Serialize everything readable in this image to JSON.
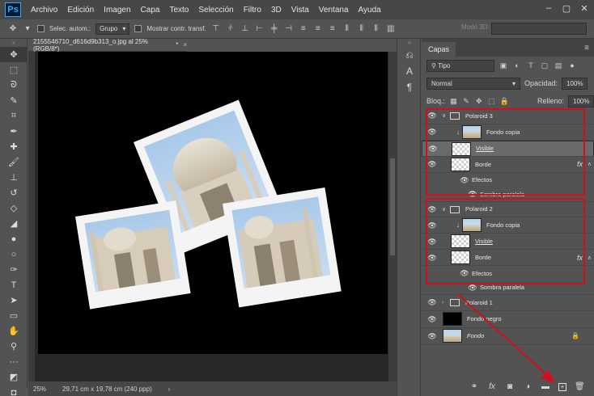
{
  "app": {
    "logo": "Ps"
  },
  "menu": [
    "Archivo",
    "Edición",
    "Imagen",
    "Capa",
    "Texto",
    "Selección",
    "Filtro",
    "3D",
    "Vista",
    "Ventana",
    "Ayuda"
  ],
  "options": {
    "auto_select_label": "Selec. autom.:",
    "auto_select_value": "Grupo",
    "transform_label": "Mostrar contr. transf.",
    "mode3d_label": "Modo 3D:"
  },
  "document": {
    "tab_title": "2155546710_d616d9b313_o.jpg al 25% (RGB/8*)",
    "tab_modified": "*",
    "close": "×"
  },
  "status": {
    "zoom": "25%",
    "size": "29,71 cm x 19,78 cm (240 ppp)"
  },
  "layers_panel": {
    "tab": "Capas",
    "filter_kind": "Tipo",
    "blend_mode": "Normal",
    "opacity_label": "Opacidad:",
    "opacity_value": "100%",
    "lock_label": "Bloq.:",
    "fill_label": "Relleno:",
    "fill_value": "100%",
    "layers": {
      "polaroid3": "Polaroid 3",
      "fondo_copia_1": "Fondo copia",
      "visible_1": "Visible",
      "borde_1": "Borde",
      "efectos_1": "Efectos",
      "sombra_1": "Sombra paralela",
      "polaroid2": "Polaroid 2",
      "fondo_copia_2": "Fondo copia",
      "visible_2": "Visible",
      "borde_2": "Borde",
      "efectos_2": "Efectos",
      "sombra_2": "Sombra paralela",
      "polaroid1": "Polaroid 1",
      "fondo_negro": "Fondo negro",
      "fondo": "Fondo"
    },
    "fx": "fx"
  },
  "colors": {
    "annotation_red": "#d0101c",
    "canvas": "#000000",
    "ui_bg": "#535353"
  }
}
